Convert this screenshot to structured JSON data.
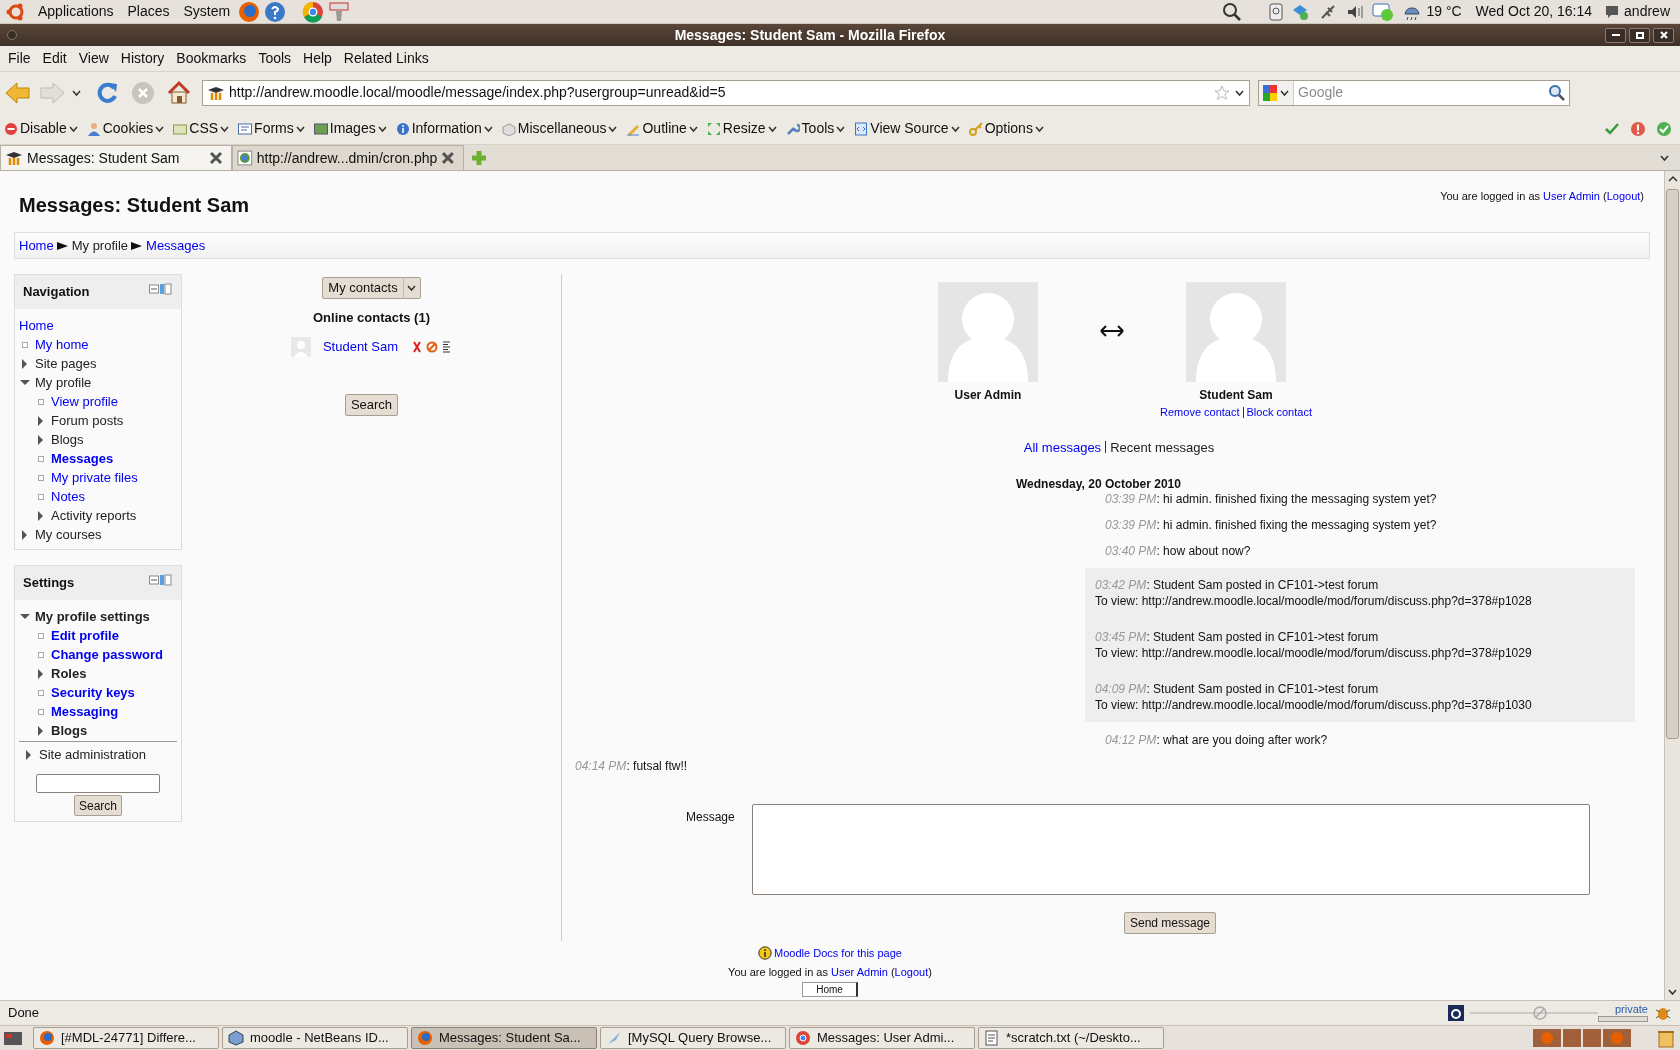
{
  "top_panel": {
    "menus": [
      "Applications",
      "Places",
      "System"
    ],
    "weather": "19 °C",
    "clock": "Wed Oct 20, 16:14",
    "user": "andrew"
  },
  "window": {
    "title": "Messages: Student Sam - Mozilla Firefox"
  },
  "menu_bar": [
    "File",
    "Edit",
    "View",
    "History",
    "Bookmarks",
    "Tools",
    "Help",
    "Related Links"
  ],
  "address_bar": {
    "url": "http://andrew.moodle.local/moodle/message/index.php?usergroup=unread&id=5"
  },
  "search_bar": {
    "placeholder": "Google"
  },
  "dev_toolbar": [
    "Disable",
    "Cookies",
    "CSS",
    "Forms",
    "Images",
    "Information",
    "Miscellaneous",
    "Outline",
    "Resize",
    "Tools",
    "View Source",
    "Options"
  ],
  "tabs": [
    {
      "label": "Messages: Student Sam",
      "selected": true
    },
    {
      "label": "http://andrew...dmin/cron.php",
      "selected": false
    }
  ],
  "page": {
    "title": "Messages: Student Sam",
    "login_info": [
      {
        "text": "You are logged in as "
      },
      {
        "link": "User Admin"
      },
      {
        "text": " ("
      },
      {
        "link": "Logout"
      },
      {
        "text": ")"
      }
    ],
    "breadcrumb": [
      {
        "label": "Home",
        "link": true
      },
      {
        "label": "My profile",
        "link": false
      },
      {
        "label": "Messages",
        "link": true
      }
    ],
    "navigation": {
      "title": "Navigation",
      "items": [
        {
          "label": "Home",
          "kind": "root",
          "link": true,
          "selected": false
        },
        {
          "label": "My home",
          "kind": "leaf",
          "link": true,
          "selected": false
        },
        {
          "label": "Site pages",
          "kind": "branch",
          "link": false,
          "expanded": false,
          "selected": false
        },
        {
          "label": "My profile",
          "kind": "branch",
          "link": false,
          "expanded": true,
          "selected": false,
          "children": [
            {
              "label": "View profile",
              "kind": "leaf",
              "link": true,
              "selected": false
            },
            {
              "label": "Forum posts",
              "kind": "branch",
              "link": false,
              "expanded": false,
              "selected": false
            },
            {
              "label": "Blogs",
              "kind": "branch",
              "link": false,
              "expanded": false,
              "selected": false
            },
            {
              "label": "Messages",
              "kind": "leaf",
              "link": true,
              "selected": true
            },
            {
              "label": "My private files",
              "kind": "leaf",
              "link": true,
              "selected": false
            },
            {
              "label": "Notes",
              "kind": "leaf",
              "link": true,
              "selected": false
            },
            {
              "label": "Activity reports",
              "kind": "branch",
              "link": false,
              "expanded": false,
              "selected": false
            }
          ]
        },
        {
          "label": "My courses",
          "kind": "branch",
          "link": false,
          "expanded": false,
          "selected": false
        }
      ]
    },
    "settings": {
      "title": "Settings",
      "groups": [
        {
          "bold": true,
          "items": [
            {
              "label": "My profile settings",
              "kind": "branch",
              "link": false,
              "expanded": true,
              "children": [
                {
                  "label": "Edit profile",
                  "kind": "leaf",
                  "link": true
                },
                {
                  "label": "Change password",
                  "kind": "leaf",
                  "link": true
                },
                {
                  "label": "Roles",
                  "kind": "branch",
                  "link": false,
                  "expanded": false
                },
                {
                  "label": "Security keys",
                  "kind": "leaf",
                  "link": true
                },
                {
                  "label": "Messaging",
                  "kind": "leaf",
                  "link": true
                },
                {
                  "label": "Blogs",
                  "kind": "branch",
                  "link": false,
                  "expanded": false
                }
              ]
            }
          ]
        },
        {
          "bold": false,
          "items": [
            {
              "label": "Site administration",
              "kind": "branch",
              "link": false,
              "expanded": false
            }
          ]
        }
      ],
      "search_button": "Search"
    },
    "contacts": {
      "selector": "My contacts",
      "heading": "Online contacts (1)",
      "items": [
        {
          "name": "Student Sam"
        }
      ],
      "search_button": "Search"
    },
    "participants": [
      {
        "name": "User Admin"
      },
      {
        "name": "Student Sam",
        "links": [
          "Remove contact",
          "Block contact"
        ]
      }
    ],
    "view_links": [
      {
        "label": "All messages",
        "selected": false
      },
      {
        "label": "Recent messages",
        "selected": true
      }
    ],
    "date": "Wednesday, 20 October 2010",
    "messages": [
      {
        "outgoing": false,
        "kind": "message",
        "time": "03:39 PM",
        "text": ": hi admin. finished fixing the messaging system yet?"
      },
      {
        "outgoing": false,
        "kind": "message",
        "time": "03:39 PM",
        "text": ": hi admin. finished fixing the messaging system yet?"
      },
      {
        "outgoing": false,
        "kind": "message",
        "time": "03:40 PM",
        "text": ": how about now?"
      },
      {
        "kind": "notification",
        "time": "03:42 PM",
        "text": ": Student Sam posted in CF101->test forum",
        "link_line": "To view: http://andrew.moodle.local/moodle/mod/forum/discuss.php?d=378#p1028"
      },
      {
        "kind": "notification",
        "time": "03:45 PM",
        "text": ": Student Sam posted in CF101->test forum",
        "link_line": "To view: http://andrew.moodle.local/moodle/mod/forum/discuss.php?d=378#p1029"
      },
      {
        "kind": "notification",
        "time": "04:09 PM",
        "text": ": Student Sam posted in CF101->test forum",
        "link_line": "To view: http://andrew.moodle.local/moodle/mod/forum/discuss.php?d=378#p1030"
      },
      {
        "outgoing": false,
        "kind": "message",
        "time": "04:12 PM",
        "text": ": what are you doing after work?"
      },
      {
        "outgoing": true,
        "kind": "message",
        "time": "04:14 PM",
        "text": ": futsal ftw!!"
      }
    ],
    "message_form": {
      "label": "Message",
      "button": "Send message"
    },
    "footer": {
      "docs_link": "Moodle Docs for this page",
      "login_info": [
        {
          "text": "You are logged in as "
        },
        {
          "link": "User Admin"
        },
        {
          "text": " ("
        },
        {
          "link": "Logout"
        },
        {
          "text": ")"
        }
      ],
      "home_button": "Home"
    }
  },
  "status_bar": {
    "text": "Done",
    "private_label": "private"
  },
  "taskbar": [
    {
      "label": "[#MDL-24771] Differe...",
      "selected": false
    },
    {
      "label": "moodle - NetBeans ID...",
      "selected": false
    },
    {
      "label": "Messages: Student Sa...",
      "selected": true
    },
    {
      "label": "[MySQL Query Browse...",
      "selected": false
    },
    {
      "label": "Messages: User Admi...",
      "selected": false
    },
    {
      "label": "*scratch.txt (~/Deskto...",
      "selected": false
    }
  ]
}
